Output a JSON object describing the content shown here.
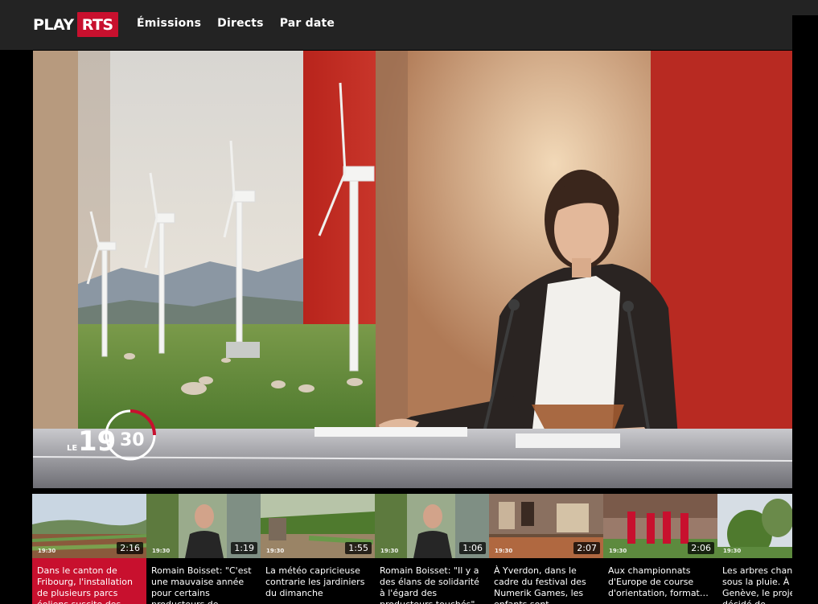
{
  "header": {
    "logo_play": "PLAY",
    "logo_rts": "RTS",
    "nav": [
      "Émissions",
      "Directs",
      "Par date"
    ]
  },
  "player": {
    "show_logo_prefix": "LE",
    "show_logo_main": "19",
    "show_logo_suffix": "30"
  },
  "videos": [
    {
      "caption": "Dans le canton de Fribourg, l'installation de plusieurs parcs éoliens suscite des…",
      "duration": "2:16",
      "active": true
    },
    {
      "caption": "Romain Boisset: \"C'est une mauvaise année pour certains producteurs de…",
      "duration": "1:19"
    },
    {
      "caption": "La météo capricieuse contrarie les jardiniers du dimanche",
      "duration": "1:55"
    },
    {
      "caption": "Romain Boisset: \"Il y a des élans de solidarité à l'égard des producteurs touchés\"",
      "duration": "1:06"
    },
    {
      "caption": "À Yverdon, dans le cadre du festival des Numerik Games, les enfants sont…",
      "duration": "2:07"
    },
    {
      "caption": "Aux championnats d'Europe de course d'orientation, format…",
      "duration": "2:06"
    },
    {
      "caption": "Les arbres chantent sous la pluie. À Genève, le projet a décidé de…",
      "duration": ""
    }
  ],
  "thumb_badge": "19:30",
  "colors": {
    "brand_red": "#c8102e",
    "header_bg": "#232323"
  }
}
